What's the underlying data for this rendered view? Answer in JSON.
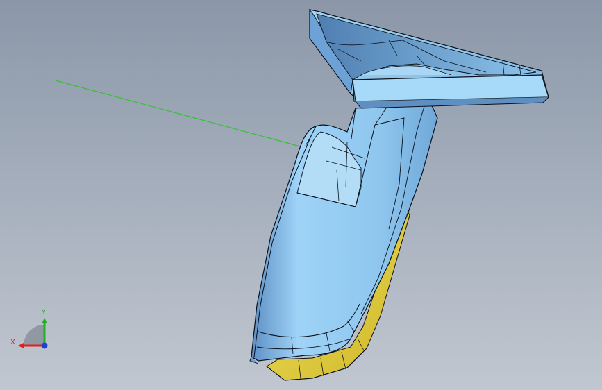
{
  "viewport": {
    "background_top": "#8b97a8",
    "background_bottom": "#c1c7d0"
  },
  "model": {
    "part_color": "#8fc8ee",
    "part_shadow_color": "#5f8fc0",
    "edge_color": "#0a0f1a",
    "gasket_color": "#e6d33a",
    "sketch_line_color": "#2fc42f"
  },
  "triad": {
    "x_label": "X",
    "y_label": "Y",
    "x_color": "#e0201a",
    "y_color": "#21b021",
    "z_color": "#1f3fd8"
  }
}
